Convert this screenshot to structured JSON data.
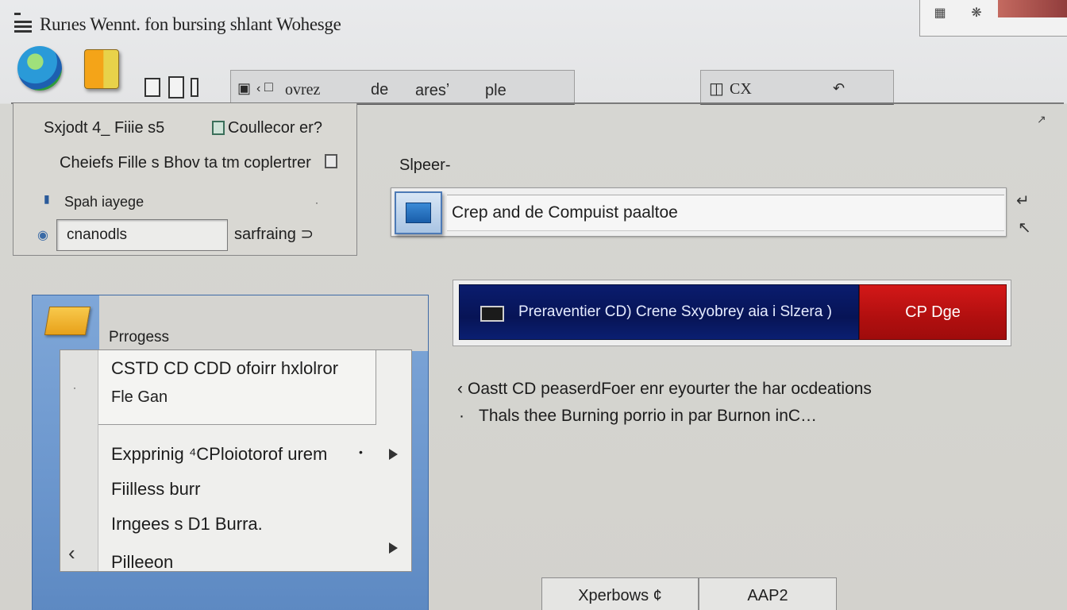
{
  "window": {
    "title": "Rurıes Wennt. fon bursing shlant Wohesge"
  },
  "toolbar": {
    "group1": {
      "item1": "ovrez",
      "item2": "de",
      "item3": "aresʼ",
      "item4": "ple"
    },
    "group2": {
      "item1": "CX"
    }
  },
  "left_group": {
    "subject_label": "Sxjodt 4_ Fiiie s5",
    "collector_label": "Coullecor er?",
    "files_label": "Cheiefs Fille s Bhov ta tm coplertrer",
    "spah_label": "Spah iayege",
    "field_value": "cnanodls",
    "sarfraing_label": "sarfraing ⊃"
  },
  "search": {
    "label": "Slpeer-",
    "value": "Crep and de Compuist paaltoe"
  },
  "progress": {
    "text": "Preraventier CD) Crene Sxyobrey aia i Slzera )",
    "button_label": "CP Dge",
    "fraction": 0.73
  },
  "status": {
    "line1": "Oastt CD peaserdFoer enr eyourter the har ocdeations",
    "line2": "Thals thee Burning porrio in par Burnon inC…"
  },
  "panel": {
    "header": "Prrogess",
    "top_line1": "CSTD CD CDD ofoirr hxlolror",
    "top_line2": "Fle Gan",
    "items": [
      "Expprinig ⁴CPloiotorof urem",
      "Fiilless burr",
      "Irngees s D1 Burra.",
      "Pilleeon"
    ]
  },
  "bottom": {
    "btn1": "Xperbows ¢",
    "btn2": "AAP2"
  }
}
